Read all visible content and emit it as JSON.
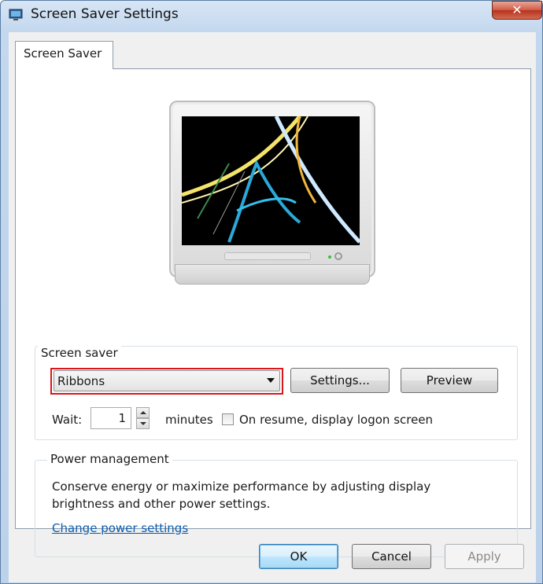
{
  "window": {
    "title": "Screen Saver Settings",
    "close_glyph": "✕"
  },
  "tabs": [
    {
      "label": "Screen Saver"
    }
  ],
  "screen_saver": {
    "group_label": "Screen saver",
    "selected": "Ribbons",
    "settings_label": "Settings...",
    "preview_label": "Preview",
    "wait_label": "Wait:",
    "wait_value": "1",
    "minutes_label": "minutes",
    "resume_label": "On resume, display logon screen",
    "resume_checked": false
  },
  "power": {
    "group_label": "Power management",
    "description": "Conserve energy or maximize performance by adjusting display brightness and other power settings.",
    "link": "Change power settings"
  },
  "footer": {
    "ok_label": "OK",
    "cancel_label": "Cancel",
    "apply_label": "Apply",
    "apply_enabled": false
  },
  "colors": {
    "highlight_border": "#d9161c",
    "link": "#0c5cad",
    "window_frame": "#c3d7ee"
  }
}
